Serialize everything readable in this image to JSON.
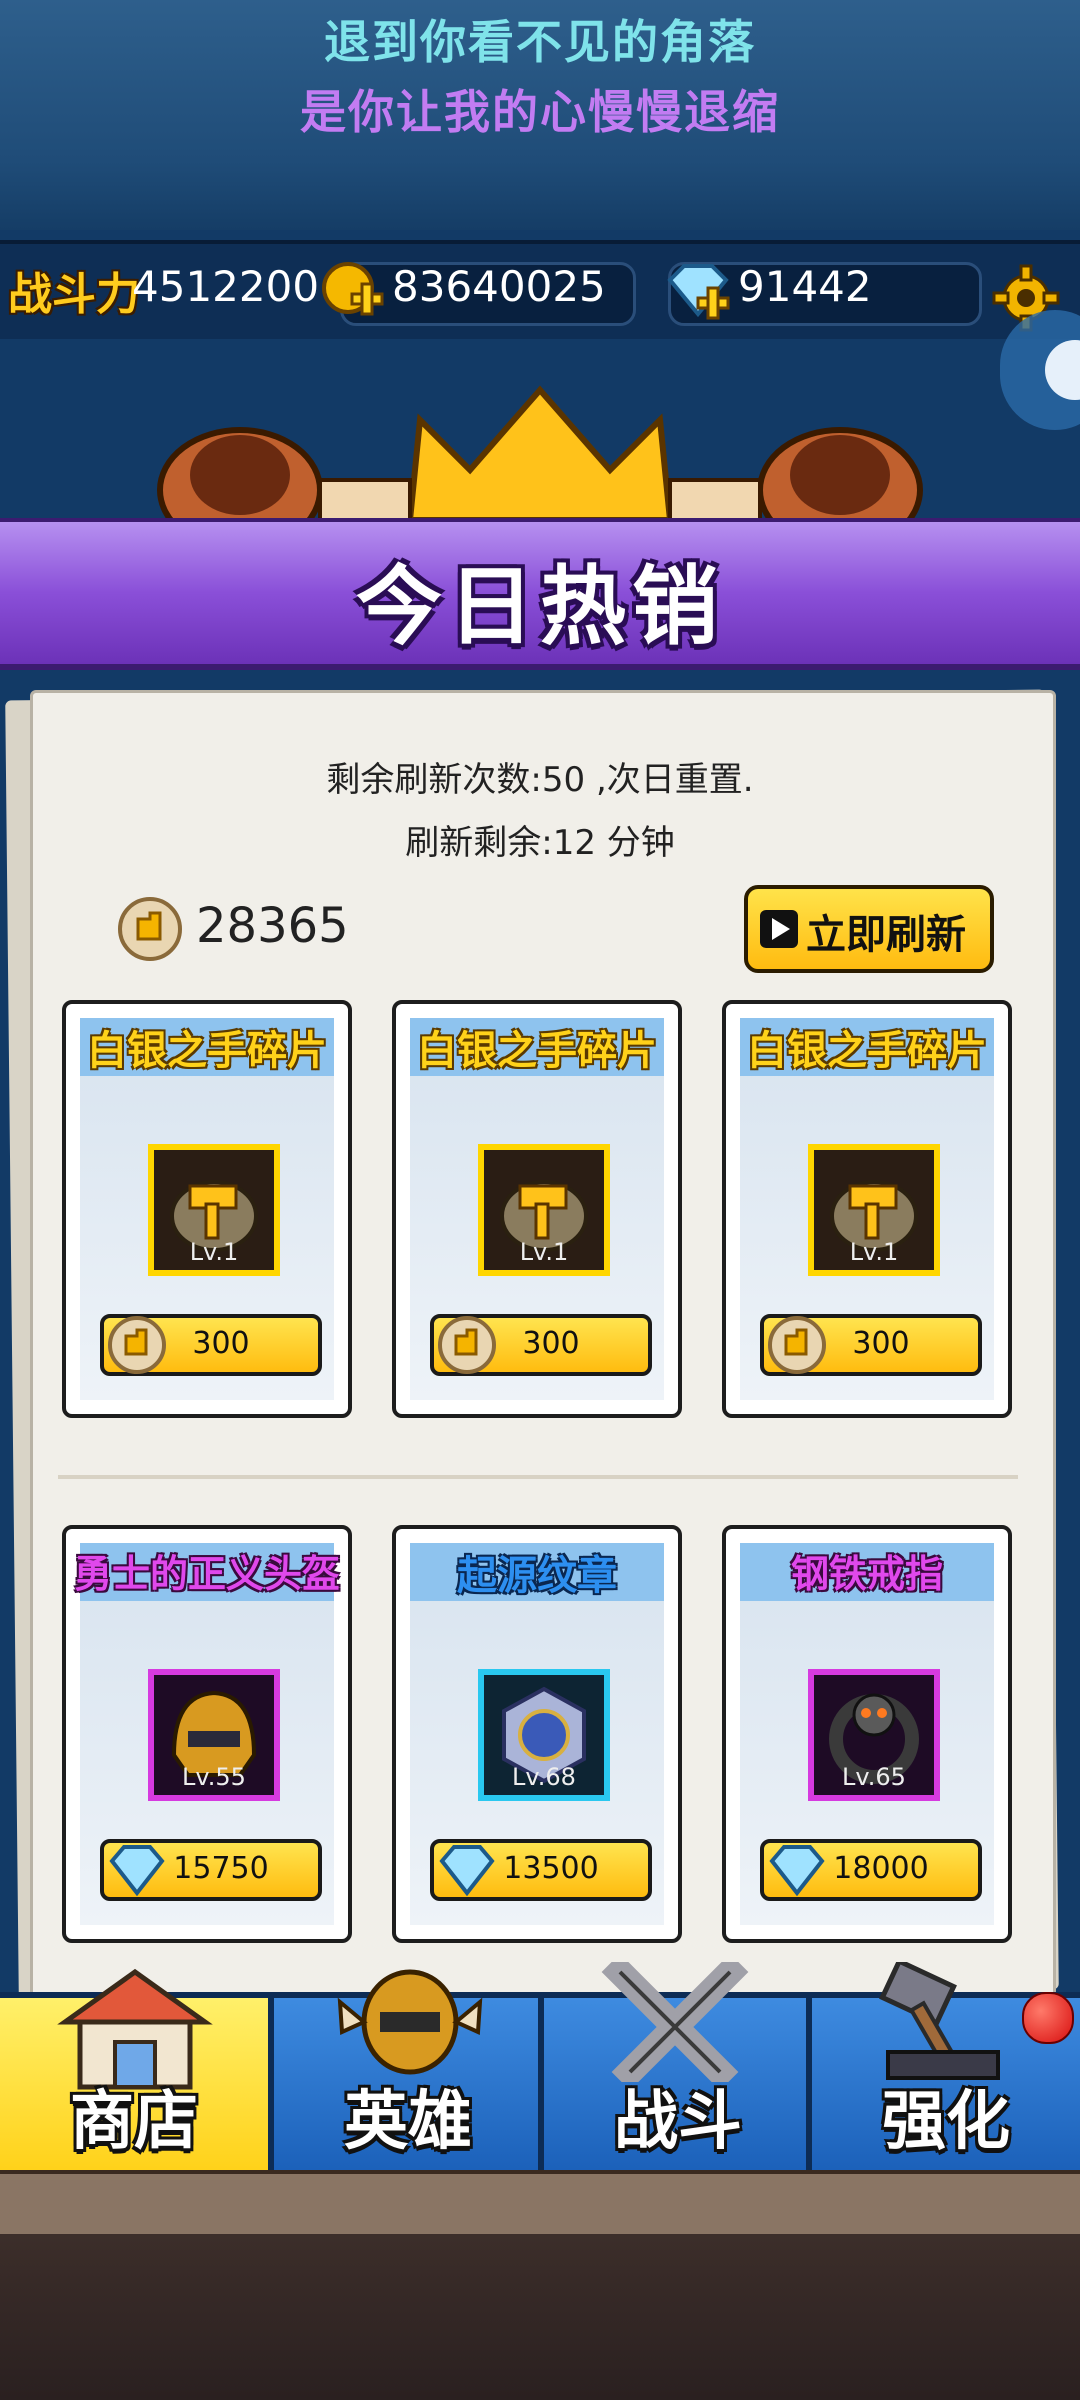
{
  "lyrics": {
    "line1": "退到你看不见的角落",
    "line2": "是你让我的心慢慢退缩"
  },
  "stats": {
    "power_label": "战斗力",
    "power_value": "4512200",
    "gold": "83640025",
    "gems": "91442"
  },
  "banner": {
    "title": "今日热销"
  },
  "shop": {
    "refresh_count_text": "剩余刷新次数:50 ,次日重置.",
    "refresh_timer_text": "刷新剩余:12 分钟",
    "medal_balance": "28365",
    "refresh_button": "立即刷新"
  },
  "items": [
    {
      "name": "白银之手碎片",
      "level": "Lv.1",
      "price": "300",
      "currency": "medal-icon",
      "rarity": "yellow"
    },
    {
      "name": "白银之手碎片",
      "level": "Lv.1",
      "price": "300",
      "currency": "medal-icon",
      "rarity": "yellow"
    },
    {
      "name": "白银之手碎片",
      "level": "Lv.1",
      "price": "300",
      "currency": "medal-icon",
      "rarity": "yellow"
    },
    {
      "name": "勇士的正义头盔",
      "level": "Lv.55",
      "price": "15750",
      "currency": "gem-icon",
      "rarity": "purple"
    },
    {
      "name": "起源纹章",
      "level": "Lv.68",
      "price": "13500",
      "currency": "gem-icon",
      "rarity": "blue"
    },
    {
      "name": "钢铁戒指",
      "level": "Lv.65",
      "price": "18000",
      "currency": "gem-icon",
      "rarity": "purple"
    }
  ],
  "nav": {
    "shop": "商店",
    "heroes": "英雄",
    "battle": "战斗",
    "enhance": "强化"
  }
}
